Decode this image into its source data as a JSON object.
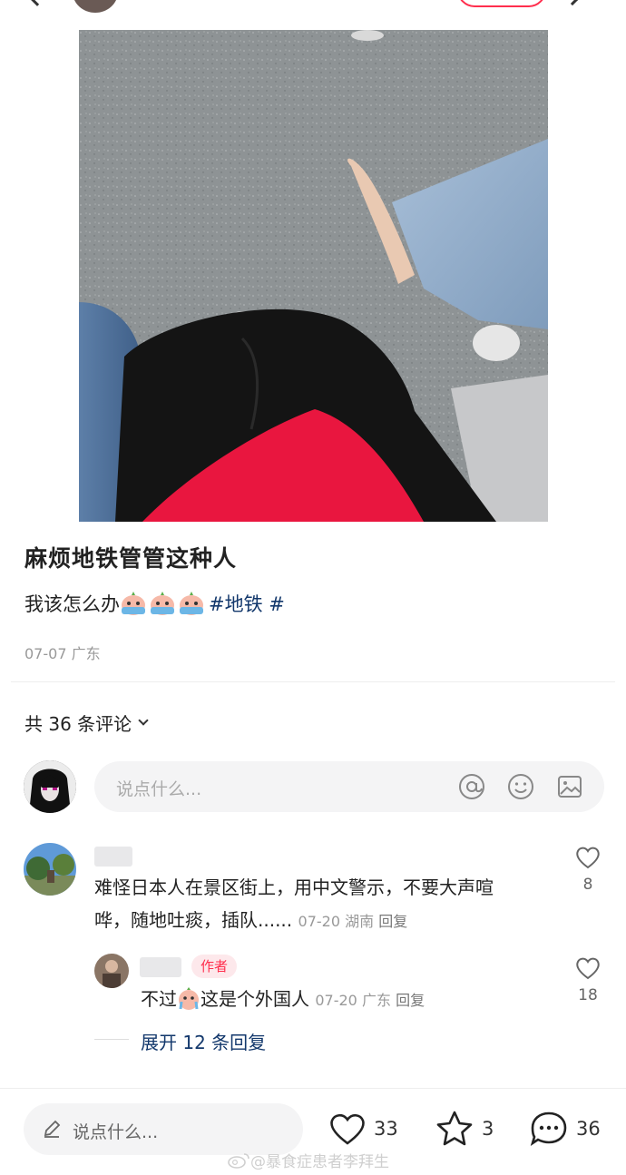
{
  "colors": {
    "accent": "#ff2e4d",
    "link": "#13386c",
    "muted": "#999999"
  },
  "header": {
    "back_icon": "back-arrow-icon",
    "follow_button_label": ""
  },
  "post": {
    "title": "麻烦地铁管管这种人",
    "body_text": "我该怎么办",
    "emoji_count": 3,
    "hashtag": "#地铁 #",
    "date": "07-07",
    "location": "广东"
  },
  "comments_header": {
    "label": "共 36 条评论"
  },
  "comment_input": {
    "placeholder": "说点什么..."
  },
  "comments": [
    {
      "text_line1": "难怪日本人在景区街上，用中文警示，不要大声喧",
      "text_line2": "哗，随地吐痰，插队......",
      "date": "07-20",
      "location": "湖南",
      "reply_label": "回复",
      "likes": "8"
    }
  ],
  "reply": {
    "author_badge": "作者",
    "text_before": "不过",
    "text_after": "这是个外国人",
    "date": "07-20",
    "location": "广东",
    "reply_label": "回复",
    "likes": "18"
  },
  "expand_replies": "展开 12 条回复",
  "bottom_bar": {
    "placeholder": "说点什么...",
    "likes": "33",
    "stars": "3",
    "comments": "36"
  },
  "watermark": "@暴食症患者李拜生"
}
